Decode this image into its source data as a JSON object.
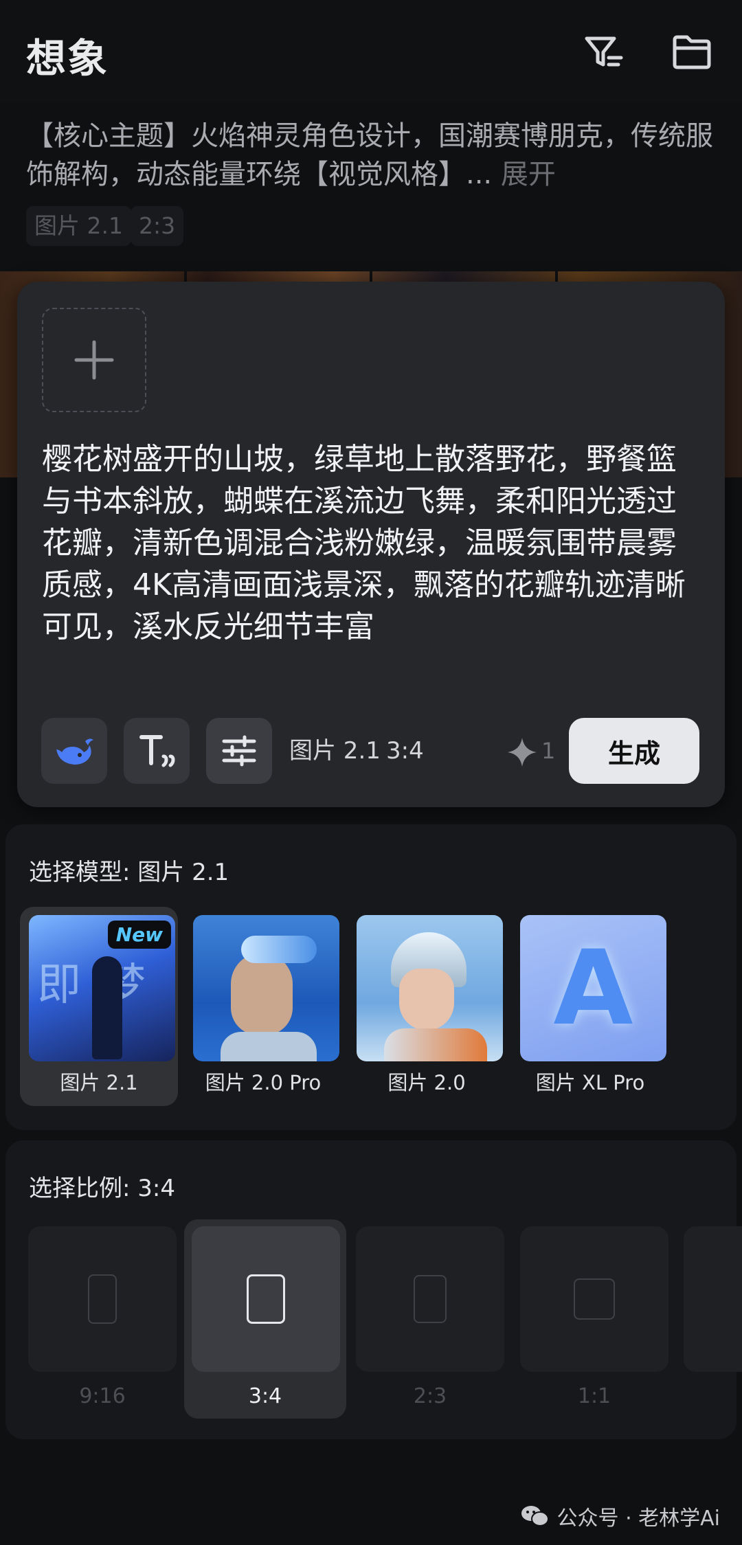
{
  "header": {
    "title": "想象",
    "filter_icon": "filter-icon",
    "folder_icon": "folder-icon"
  },
  "previous": {
    "text": "【核心主题】火焰神灵角色设计，国潮赛博朋克，传统服饰解构，动态能量环绕【视觉风格】...",
    "expand_label": "展开",
    "tags": [
      "图片 2.1",
      "2:3"
    ]
  },
  "editor": {
    "prompt": "樱花树盛开的山坡，绿草地上散落野花，野餐篮与书本斜放，蝴蝶在溪流边飞舞，柔和阳光透过花瓣，清新色调混合浅粉嫩绿，温暖氛围带晨雾质感，4K高清画面浅景深，飘落的花瓣轨迹清晰可见，溪水反光细节丰富",
    "model_value": "图片 2.1",
    "ratio_value": "3:4",
    "credits": "1",
    "generate_label": "生成"
  },
  "model_panel": {
    "title": "选择模型: 图片 2.1",
    "selected_index": 0,
    "models": [
      {
        "label": "图片 2.1",
        "badge": "New",
        "thumb_text": "即梦"
      },
      {
        "label": "图片 2.0 Pro"
      },
      {
        "label": "图片 2.0"
      },
      {
        "label": "图片 XL Pro",
        "thumb_text": "A"
      }
    ]
  },
  "ratio_panel": {
    "title": "选择比例: 3:4",
    "selected_index": 1,
    "ratios": [
      {
        "label": "9:16"
      },
      {
        "label": "3:4"
      },
      {
        "label": "2:3"
      },
      {
        "label": "1:1"
      }
    ]
  },
  "watermark": {
    "text": "公众号 · 老林学Ai"
  },
  "colors": {
    "background": "#0f1012",
    "card": "#25272b",
    "generate_button": "#e6e8ec",
    "badge_text": "#56c7ff"
  }
}
